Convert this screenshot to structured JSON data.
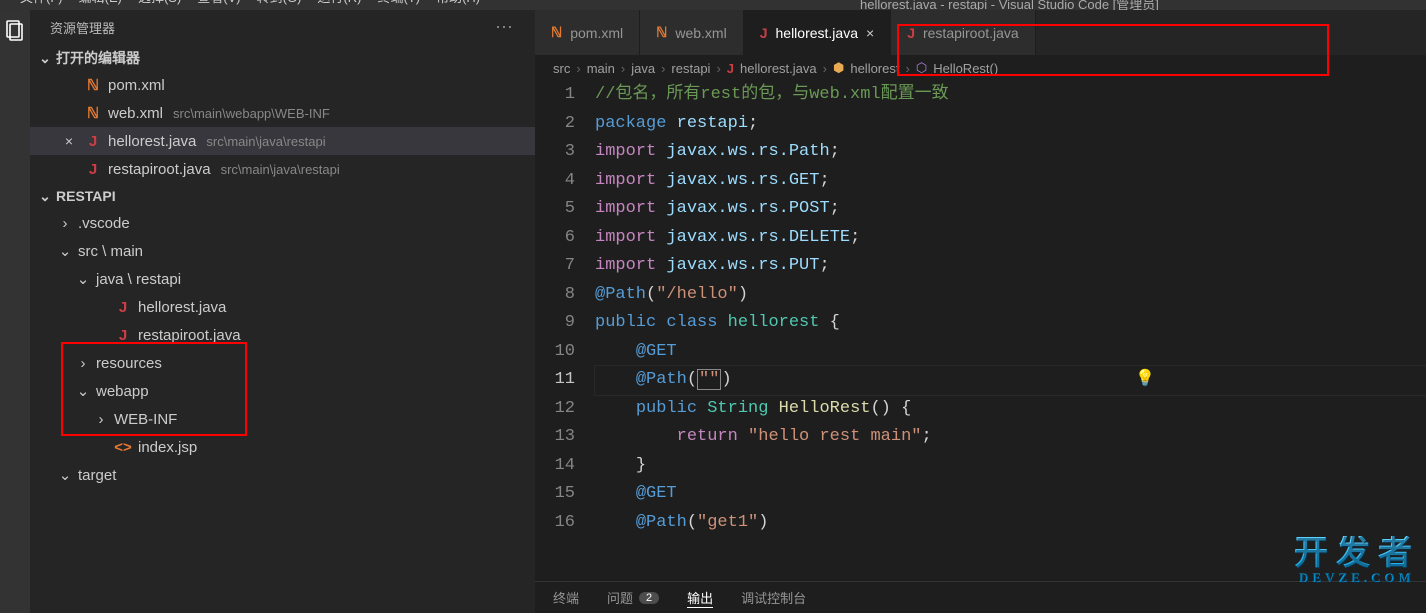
{
  "window": {
    "title": "hellorest.java - restapi - Visual Studio Code [管理员]"
  },
  "menubar": [
    "文件(F)",
    "编辑(E)",
    "选择(S)",
    "查看(V)",
    "转到(G)",
    "运行(R)",
    "终端(T)",
    "帮助(H)"
  ],
  "explorer": {
    "title": "资源管理器",
    "open_editors_label": "打开的编辑器",
    "open_editors": [
      {
        "icon": "xml-icon",
        "icoClass": "ico-xml",
        "glyph": "ℕ",
        "name": "pom.xml",
        "path": ""
      },
      {
        "icon": "xml-icon",
        "icoClass": "ico-xml",
        "glyph": "ℕ",
        "name": "web.xml",
        "path": "src\\main\\webapp\\WEB-INF"
      },
      {
        "icon": "java-icon",
        "icoClass": "ico-java",
        "glyph": "J",
        "name": "hellorest.java",
        "path": "src\\main\\java\\restapi",
        "active": true,
        "close": true
      },
      {
        "icon": "java-icon",
        "icoClass": "ico-java",
        "glyph": "J",
        "name": "restapiroot.java",
        "path": "src\\main\\java\\restapi"
      }
    ],
    "project": "RESTAPI",
    "tree": [
      {
        "kind": "folder",
        "chev": "›",
        "name": ".vscode",
        "indent": 1
      },
      {
        "kind": "folder",
        "chev": "⌄",
        "name": "src \\ main",
        "indent": 1
      },
      {
        "kind": "folder",
        "chev": "⌄",
        "name": "java \\ restapi",
        "indent": 2
      },
      {
        "kind": "file",
        "icon": "java-icon",
        "icoClass": "ico-java",
        "glyph": "J",
        "name": "hellorest.java",
        "indent": 3
      },
      {
        "kind": "file",
        "icon": "java-icon",
        "icoClass": "ico-java",
        "glyph": "J",
        "name": "restapiroot.java",
        "indent": 3
      },
      {
        "kind": "folder",
        "chev": "›",
        "name": "resources",
        "indent": 2
      },
      {
        "kind": "folder",
        "chev": "⌄",
        "name": "webapp",
        "indent": 2
      },
      {
        "kind": "folder",
        "chev": "›",
        "name": "WEB-INF",
        "indent": 3
      },
      {
        "kind": "file",
        "icon": "jsp-icon",
        "icoClass": "ico-jsp",
        "glyph": "<>",
        "name": "index.jsp",
        "indent": 3
      },
      {
        "kind": "folder",
        "chev": "⌄",
        "name": "target",
        "indent": 1
      }
    ]
  },
  "tabs": [
    {
      "icon": "xml-icon",
      "icoClass": "ico-xml",
      "glyph": "ℕ",
      "label": "pom.xml"
    },
    {
      "icon": "xml-icon",
      "icoClass": "ico-xml",
      "glyph": "ℕ",
      "label": "web.xml"
    },
    {
      "icon": "java-icon",
      "icoClass": "ico-java",
      "glyph": "J",
      "label": "hellorest.java",
      "active": true,
      "close": true
    },
    {
      "icon": "java-icon",
      "icoClass": "ico-java",
      "glyph": "J",
      "label": "restapiroot.java"
    }
  ],
  "breadcrumb": {
    "parts": [
      "src",
      "main",
      "java",
      "restapi"
    ],
    "file": "hellorest.java",
    "class": "hellorest",
    "method": "HelloRest()"
  },
  "code": {
    "first_line": 1,
    "current_line": 11,
    "lines_html": [
      "<span class='c-comment'>//包名，所有rest的包，与web.xml配置一致</span>",
      "<span class='c-kw2'>package</span> <span class='c-ident'>restapi</span><span class='c-punc'>;</span>",
      "<span class='c-keyword'>import</span> <span class='c-ident'>javax.ws.rs.Path</span><span class='c-punc'>;</span>",
      "<span class='c-keyword'>import</span> <span class='c-ident'>javax.ws.rs.GET</span><span class='c-punc'>;</span>",
      "<span class='c-keyword'>import</span> <span class='c-ident'>javax.ws.rs.POST</span><span class='c-punc'>;</span>",
      "<span class='c-keyword'>import</span> <span class='c-ident'>javax.ws.rs.DELETE</span><span class='c-punc'>;</span>",
      "<span class='c-keyword'>import</span> <span class='c-ident'>javax.ws.rs.PUT</span><span class='c-punc'>;</span>",
      "<span class='c-annotation'>@Path</span><span class='c-punc'>(</span><span class='c-string'>\"/hello\"</span><span class='c-punc'>)</span>",
      "<span class='c-kw2'>public</span> <span class='c-kw2'>class</span> <span class='c-type'>hellorest</span> <span class='c-punc'>{</span>",
      "    <span class='c-annotation'>@GET</span>",
      "    <span class='c-annotation'>@Path</span><span class='c-punc'>(</span><span class='c-string cursor-box'>\"\"</span><span class='c-punc'>)</span>",
      "    <span class='c-kw2'>public</span> <span class='c-type'>String</span> <span class='c-func'>HelloRest</span><span class='c-punc'>() {</span>",
      "        <span class='c-keyword'>return</span> <span class='c-string'>\"hello rest main\"</span><span class='c-punc'>;</span>",
      "    <span class='c-punc'>}</span>",
      "    <span class='c-annotation'>@GET</span>",
      "    <span class='c-annotation'>@Path</span><span class='c-punc'>(</span><span class='c-string'>\"get1\"</span><span class='c-punc'>)</span>"
    ]
  },
  "panel": {
    "tabs": [
      {
        "label": "终端"
      },
      {
        "label": "问题",
        "badge": "2"
      },
      {
        "label": "输出",
        "active": true
      },
      {
        "label": "调试控制台"
      }
    ]
  },
  "watermark": {
    "line1": "开发者",
    "line2": "DEVZE.COM"
  }
}
